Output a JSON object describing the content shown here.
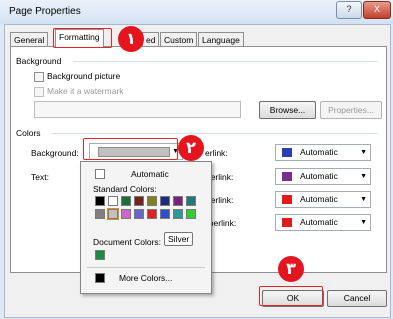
{
  "window": {
    "title": "Page Properties",
    "help_label": "?",
    "close_label": "X"
  },
  "tabs": [
    {
      "label": "General"
    },
    {
      "label": "Formatting"
    },
    {
      "label": "ed"
    },
    {
      "label": "Custom"
    },
    {
      "label": "Language"
    }
  ],
  "background": {
    "group_label": "Background",
    "bg_picture_label": "Background picture",
    "watermark_label": "Make it a watermark",
    "path_value": "",
    "browse_label": "Browse...",
    "properties_label": "Properties..."
  },
  "colors": {
    "group_label": "Colors",
    "background_label": "Background:",
    "background_value": "Silver",
    "text_label": "Text:",
    "hyperlink_label": "erlink:",
    "visited_label": "hyperlink:",
    "active_label": "hyperlink:",
    "followed_label": "ed hyperlink:",
    "right_combos": [
      {
        "value": "Automatic",
        "color": "#2a3fb0"
      },
      {
        "value": "Automatic",
        "color": "#7b2d8e"
      },
      {
        "value": "Automatic",
        "color": "#e01b1b"
      },
      {
        "value": "Automatic",
        "color": "#e01b1b"
      }
    ]
  },
  "dropdown": {
    "automatic_label": "Automatic",
    "standard_label": "Standard Colors:",
    "standard_colors": [
      "#000000",
      "#ffffff",
      "#1f6b3a",
      "#7a1f1f",
      "#80801f",
      "#1f2a80",
      "#7a1f7a",
      "#1f7a7a",
      "#808080",
      "#c0c0c0",
      "#cc66cc",
      "#6666cc",
      "#dd2222",
      "#2a50c8",
      "#2a9a9a",
      "#33cc33"
    ],
    "selected_index": 9,
    "document_label": "Document Colors:",
    "document_colors": [
      "#1f8a3f"
    ],
    "tooltip": "Silver",
    "more_label": "More Colors..."
  },
  "footer": {
    "ok_label": "OK",
    "cancel_label": "Cancel"
  },
  "markers": [
    {
      "label": "١"
    },
    {
      "label": "٢"
    },
    {
      "label": "٣"
    }
  ]
}
